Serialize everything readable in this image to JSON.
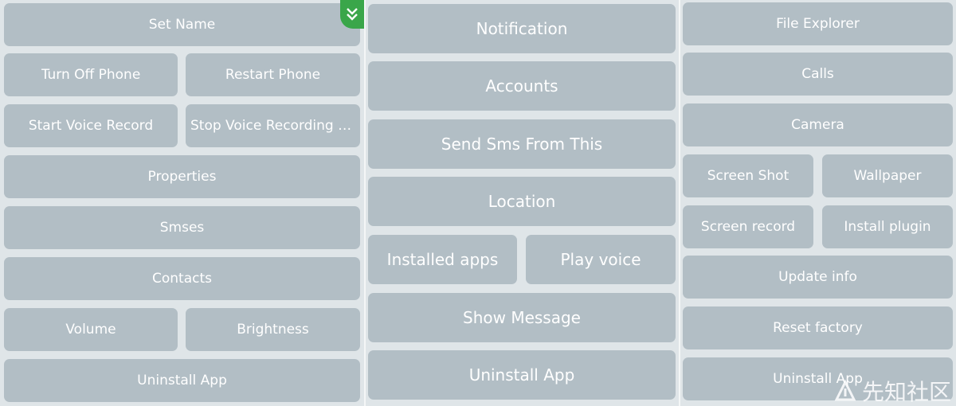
{
  "left_panel": {
    "buttons": [
      "Set Name",
      "Turn Off Phone",
      "Restart Phone",
      "Start Voice Record",
      "Stop Voice Recording a...",
      "Properties",
      "Smses",
      "Contacts",
      "Volume",
      "Brightness",
      "Uninstall App"
    ],
    "badge_icon": "double-chevron-down-icon"
  },
  "middle_panel": {
    "buttons": [
      "Notification",
      "Accounts",
      "Send Sms From This",
      "Location",
      "Installed apps",
      "Play voice",
      "Show Message",
      "Uninstall App"
    ]
  },
  "right_panel": {
    "buttons": [
      "File Explorer",
      "Calls",
      "Camera",
      "Screen Shot",
      "Wallpaper",
      "Screen record",
      "Install plugin",
      "Update info",
      "Reset factory",
      "Uninstall App"
    ]
  },
  "watermark": {
    "text": "先知社区",
    "logo_icon": "xianzhi-logo-icon"
  },
  "colors": {
    "button": "#b2bec5",
    "background": "#dfe5e8",
    "badge": "#3aa64a",
    "text": "#ffffff"
  }
}
